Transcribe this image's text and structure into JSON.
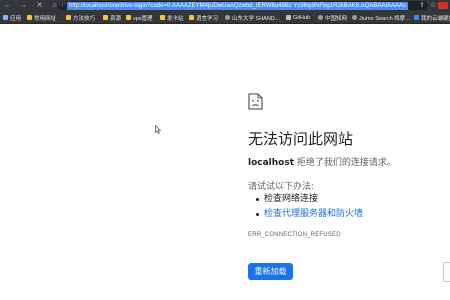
{
  "browser": {
    "back_icon": "←",
    "forward_icon": "→",
    "close_icon": "✕",
    "home_icon": "⌂",
    "info_icon": "ⓘ",
    "url": "http://localhost/onedrive-login?code=0.AAAAZEYM4jUDwUaAQzwbd_tERW8u49Bz Yc9lhp9NFbg1R2kBAK8.AQABAAIAAAAs",
    "share_icon": "⇪",
    "star_icon": "☆",
    "accent_color": "#4a8cf0"
  },
  "bookmarks": [
    {
      "label": "应用",
      "icon": "apps"
    },
    {
      "label": "常用网址",
      "icon": "folder"
    },
    {
      "label": "方法技巧",
      "icon": "folder"
    },
    {
      "label": "资源",
      "icon": "folder"
    },
    {
      "label": "vps管理",
      "icon": "folder"
    },
    {
      "label": "发卡站",
      "icon": "folder"
    },
    {
      "label": "语言学习",
      "icon": "folder"
    },
    {
      "label": "山东大学 SHAND…",
      "icon": "globe"
    },
    {
      "label": "GitHub",
      "icon": "dark"
    },
    {
      "label": "中国知网",
      "icon": "globe"
    },
    {
      "label": "Jiumo Search 鸠摩…",
      "icon": "globe"
    },
    {
      "label": "我的云端硬盘",
      "icon": "blue"
    }
  ],
  "error_page": {
    "icon": "sad-page-icon",
    "title": "无法访问此网站",
    "host": "localhost",
    "message": " 拒绝了我们的连接请求。",
    "try_label": "请试试以下办法:",
    "suggestions": [
      "检查网络连接",
      "检查代理服务器和防火墙"
    ],
    "error_code": "ERR_CONNECTION_REFUSED",
    "reload_label": "重新加载",
    "button_color": "#1a73e8"
  }
}
